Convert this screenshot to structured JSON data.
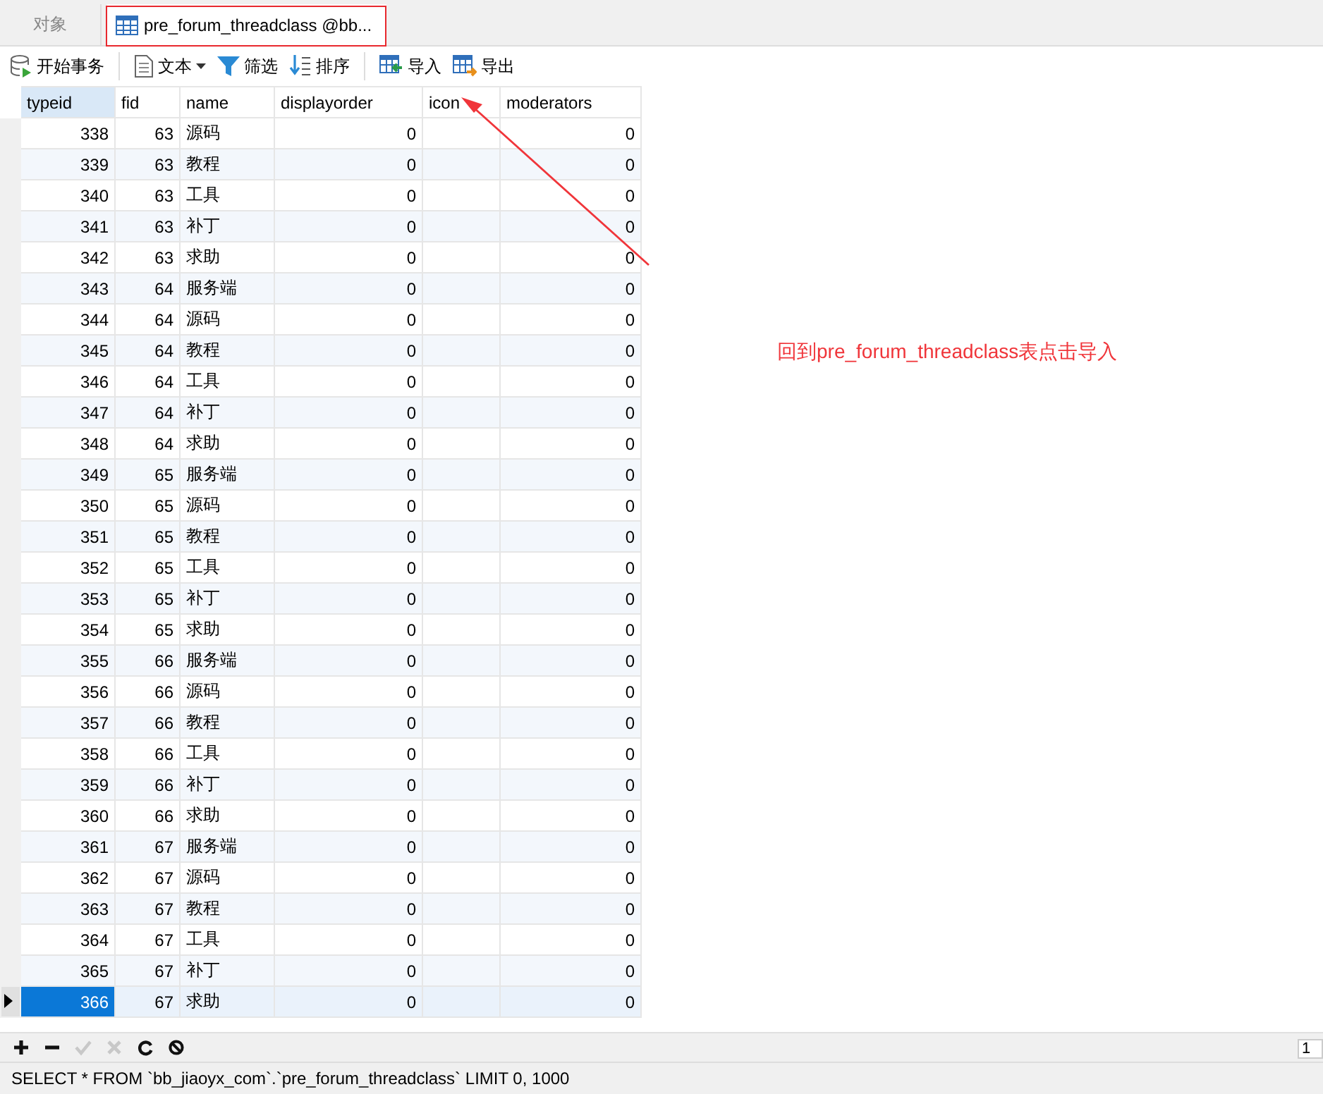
{
  "tabs": [
    {
      "label": "对象",
      "selected": false,
      "kind": "plain"
    },
    {
      "label": "pre_forum_threadclass @bb...",
      "selected": true,
      "kind": "table"
    }
  ],
  "toolbar": [
    {
      "label": "开始事务",
      "kind": "transaction",
      "caret": false
    },
    {
      "label": "文本",
      "kind": "text",
      "caret": true
    },
    {
      "label": "筛选",
      "kind": "filter",
      "caret": false
    },
    {
      "label": "排序",
      "kind": "sort",
      "caret": false
    },
    {
      "label": "导入",
      "kind": "import",
      "caret": false
    },
    {
      "label": "导出",
      "kind": "export",
      "caret": false
    }
  ],
  "table": {
    "columns": [
      "typeid",
      "fid",
      "name",
      "displayorder",
      "icon",
      "moderators"
    ],
    "rows": [
      {
        "cells": [
          "338",
          "63",
          "源码",
          "0",
          "",
          "0"
        ],
        "selected": false
      },
      {
        "cells": [
          "339",
          "63",
          "教程",
          "0",
          "",
          "0"
        ],
        "selected": false
      },
      {
        "cells": [
          "340",
          "63",
          "工具",
          "0",
          "",
          "0"
        ],
        "selected": false
      },
      {
        "cells": [
          "341",
          "63",
          "补丁",
          "0",
          "",
          "0"
        ],
        "selected": false
      },
      {
        "cells": [
          "342",
          "63",
          "求助",
          "0",
          "",
          "0"
        ],
        "selected": false
      },
      {
        "cells": [
          "343",
          "64",
          "服务端",
          "0",
          "",
          "0"
        ],
        "selected": false
      },
      {
        "cells": [
          "344",
          "64",
          "源码",
          "0",
          "",
          "0"
        ],
        "selected": false
      },
      {
        "cells": [
          "345",
          "64",
          "教程",
          "0",
          "",
          "0"
        ],
        "selected": false
      },
      {
        "cells": [
          "346",
          "64",
          "工具",
          "0",
          "",
          "0"
        ],
        "selected": false
      },
      {
        "cells": [
          "347",
          "64",
          "补丁",
          "0",
          "",
          "0"
        ],
        "selected": false
      },
      {
        "cells": [
          "348",
          "64",
          "求助",
          "0",
          "",
          "0"
        ],
        "selected": false
      },
      {
        "cells": [
          "349",
          "65",
          "服务端",
          "0",
          "",
          "0"
        ],
        "selected": false
      },
      {
        "cells": [
          "350",
          "65",
          "源码",
          "0",
          "",
          "0"
        ],
        "selected": false
      },
      {
        "cells": [
          "351",
          "65",
          "教程",
          "0",
          "",
          "0"
        ],
        "selected": false
      },
      {
        "cells": [
          "352",
          "65",
          "工具",
          "0",
          "",
          "0"
        ],
        "selected": false
      },
      {
        "cells": [
          "353",
          "65",
          "补丁",
          "0",
          "",
          "0"
        ],
        "selected": false
      },
      {
        "cells": [
          "354",
          "65",
          "求助",
          "0",
          "",
          "0"
        ],
        "selected": false
      },
      {
        "cells": [
          "355",
          "66",
          "服务端",
          "0",
          "",
          "0"
        ],
        "selected": false
      },
      {
        "cells": [
          "356",
          "66",
          "源码",
          "0",
          "",
          "0"
        ],
        "selected": false
      },
      {
        "cells": [
          "357",
          "66",
          "教程",
          "0",
          "",
          "0"
        ],
        "selected": false
      },
      {
        "cells": [
          "358",
          "66",
          "工具",
          "0",
          "",
          "0"
        ],
        "selected": false
      },
      {
        "cells": [
          "359",
          "66",
          "补丁",
          "0",
          "",
          "0"
        ],
        "selected": false
      },
      {
        "cells": [
          "360",
          "66",
          "求助",
          "0",
          "",
          "0"
        ],
        "selected": false
      },
      {
        "cells": [
          "361",
          "67",
          "服务端",
          "0",
          "",
          "0"
        ],
        "selected": false
      },
      {
        "cells": [
          "362",
          "67",
          "源码",
          "0",
          "",
          "0"
        ],
        "selected": false
      },
      {
        "cells": [
          "363",
          "67",
          "教程",
          "0",
          "",
          "0"
        ],
        "selected": false
      },
      {
        "cells": [
          "364",
          "67",
          "工具",
          "0",
          "",
          "0"
        ],
        "selected": false
      },
      {
        "cells": [
          "365",
          "67",
          "补丁",
          "0",
          "",
          "0"
        ],
        "selected": false
      },
      {
        "cells": [
          "366",
          "67",
          "求助",
          "0",
          "",
          "0"
        ],
        "selected": true
      }
    ]
  },
  "bottom_toolbar": [
    {
      "kind": "add",
      "disabled": false
    },
    {
      "kind": "remove",
      "disabled": false
    },
    {
      "kind": "apply",
      "disabled": true
    },
    {
      "kind": "cancel",
      "disabled": true
    },
    {
      "kind": "refresh",
      "disabled": false
    },
    {
      "kind": "stop",
      "disabled": false
    }
  ],
  "page_field": {
    "value": "1"
  },
  "status_bar": "SELECT * FROM `bb_jiaoyx_com`.`pre_forum_threadclass` LIMIT 0, 1000",
  "annotation": {
    "text": "回到pre_forum_threadclass表点击导入"
  }
}
